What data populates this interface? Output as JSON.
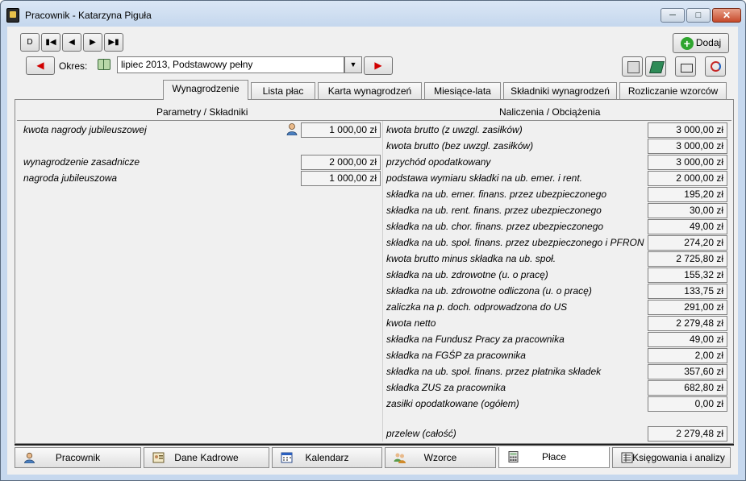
{
  "window": {
    "title": "Pracownik - Katarzyna Piguła"
  },
  "nav": {
    "first": "D",
    "prev_label": ""
  },
  "toolbar": {
    "dodaj_label": "Dodaj",
    "okres_label": "Okres:",
    "okres_value": "lipiec 2013, Podstawowy pełny"
  },
  "tabs": [
    {
      "label": "Wynagrodzenie",
      "active": true
    },
    {
      "label": "Lista płac"
    },
    {
      "label": "Karta wynagrodzeń"
    },
    {
      "label": "Miesiące-lata"
    },
    {
      "label": "Składniki wynagrodzeń"
    },
    {
      "label": "Rozliczanie wzorców"
    }
  ],
  "left_panel": {
    "header": "Parametry / Składniki",
    "rows": [
      {
        "label": "kwota nagrody jubileuszowej",
        "value": "1 000,00 zł"
      },
      {
        "label": "wynagrodzenie zasadnicze",
        "value": "2 000,00 zł"
      },
      {
        "label": "nagroda jubileuszowa",
        "value": "1 000,00 zł"
      }
    ]
  },
  "right_panel": {
    "header": "Naliczenia / Obciążenia",
    "rows": [
      {
        "label": "kwota brutto (z uwzgl. zasiłków)",
        "value": "3 000,00 zł"
      },
      {
        "label": "kwota brutto (bez uwzgl. zasiłków)",
        "value": "3 000,00 zł"
      },
      {
        "label": "przychód opodatkowany",
        "value": "3 000,00 zł"
      },
      {
        "label": "podstawa wymiaru składki na ub. emer. i rent.",
        "value": "2 000,00 zł"
      },
      {
        "label": "składka na ub. emer. finans. przez ubezpieczonego",
        "value": "195,20 zł"
      },
      {
        "label": "składka na ub. rent. finans. przez ubezpieczonego",
        "value": "30,00 zł"
      },
      {
        "label": "składka na ub. chor. finans. przez ubezpieczonego",
        "value": "49,00 zł"
      },
      {
        "label": "składka na ub. społ. finans. przez ubezpieczonego i PFRON",
        "value": "274,20 zł"
      },
      {
        "label": "kwota brutto minus składka na ub. społ.",
        "value": "2 725,80 zł"
      },
      {
        "label": "składka na ub. zdrowotne (u. o pracę)",
        "value": "155,32 zł"
      },
      {
        "label": "składka na ub. zdrowotne odliczona (u. o pracę)",
        "value": "133,75 zł"
      },
      {
        "label": "zaliczka na p. doch. odprowadzona do US",
        "value": "291,00 zł"
      },
      {
        "label": "kwota netto",
        "value": "2 279,48 zł"
      },
      {
        "label": "składka na Fundusz Pracy za pracownika",
        "value": "49,00 zł"
      },
      {
        "label": "składka na FGŚP za pracownika",
        "value": "2,00 zł"
      },
      {
        "label": "składka na ub. społ. finans. przez płatnika składek",
        "value": "357,60 zł"
      },
      {
        "label": "składka ZUS za pracownika",
        "value": "682,80 zł"
      },
      {
        "label": "zasiłki opodatkowane (ogółem)",
        "value": "0,00 zł"
      }
    ],
    "total": {
      "label": "przelew (całość)",
      "value": "2 279,48 zł"
    }
  },
  "bottom_tabs": [
    {
      "label": "Pracownik"
    },
    {
      "label": "Dane Kadrowe"
    },
    {
      "label": "Kalendarz"
    },
    {
      "label": "Wzorce"
    },
    {
      "label": "Płace",
      "active": true
    },
    {
      "label": "Księgowania i analizy"
    }
  ]
}
